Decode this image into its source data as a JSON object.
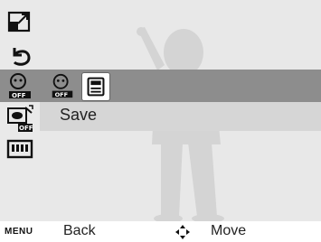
{
  "menu": {
    "options": [
      {
        "label": "Save"
      }
    ],
    "selected_submenu": "save-icon"
  },
  "left_rail": {
    "icons": [
      "resize-icon",
      "undo-icon",
      "face-retouch-off-icon",
      "red-eye-off-icon",
      "film-icon"
    ]
  },
  "submenu": {
    "icons": [
      "face-retouch-off-icon",
      "face-retouch-off-icon",
      "save-icon"
    ]
  },
  "bottom_bar": {
    "menu_key": "MENU",
    "back_label": "Back",
    "move_label": "Move",
    "move_icon": "dpad-icon"
  },
  "colors": {
    "highlight_band": "#8d8d8d",
    "option_band": "#d6d6d6",
    "background": "#e8e8e8"
  }
}
